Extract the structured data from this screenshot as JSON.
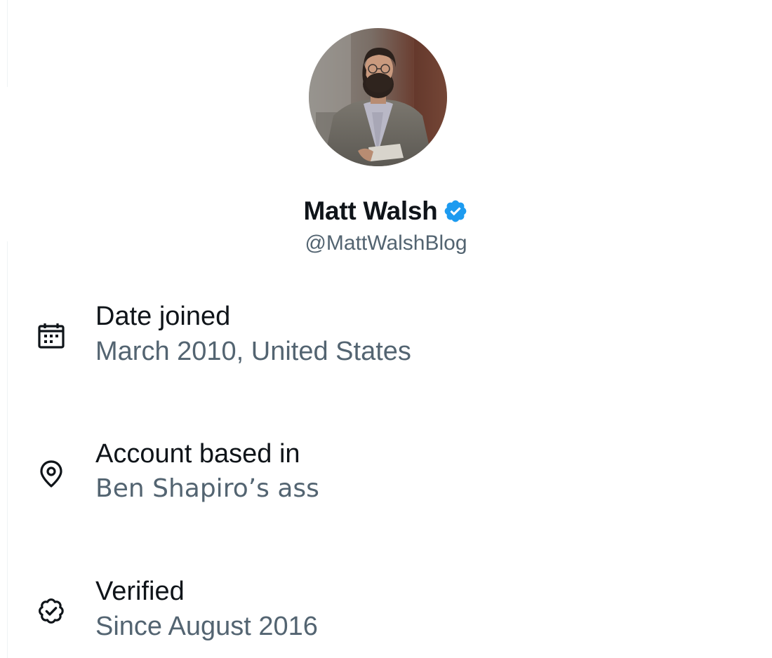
{
  "profile": {
    "display_name": "Matt Walsh",
    "handle": "@MattWalshBlog",
    "verified": true,
    "badge_color": "#1d9bf0"
  },
  "about": {
    "items": [
      {
        "icon": "calendar-icon",
        "label": "Date joined",
        "value": "March 2010, United States"
      },
      {
        "icon": "location-pin-icon",
        "label": "Account based in",
        "value": "Ben Shapiro’s ass"
      },
      {
        "icon": "verified-seal-icon",
        "label": "Verified",
        "value": "Since August 2016"
      }
    ]
  },
  "colors": {
    "primary_text": "#0f1419",
    "secondary_text": "#536471",
    "accent": "#1d9bf0",
    "background": "#ffffff"
  }
}
